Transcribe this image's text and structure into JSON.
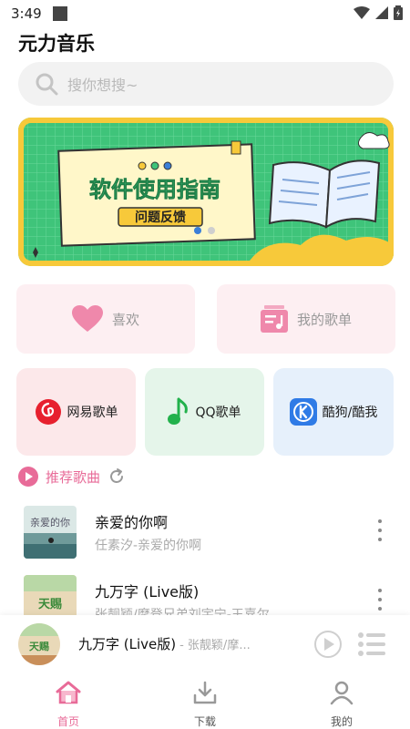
{
  "status_bar": {
    "time": "3:49"
  },
  "app": {
    "title": "元力音乐"
  },
  "search": {
    "placeholder": "搜你想搜~"
  },
  "banner": {
    "title": "软件使用指南",
    "subtitle": "问题反馈",
    "active_dot": 0,
    "dot_count": 2
  },
  "quick_actions": [
    {
      "label": "喜欢",
      "icon": "heart-icon"
    },
    {
      "label": "我的歌单",
      "icon": "playlist-icon"
    }
  ],
  "platforms": [
    {
      "label": "网易歌单",
      "icon": "netease-icon",
      "color": "#fce8ea"
    },
    {
      "label": "QQ歌单",
      "icon": "qq-music-icon",
      "color": "#e5f5ea"
    },
    {
      "label": "酷狗/酷我",
      "icon": "kugou-icon",
      "color": "#e6f0fb"
    }
  ],
  "recommend": {
    "title": "推荐歌曲"
  },
  "songs": [
    {
      "title": "亲爱的你啊",
      "subtitle": "任素汐-亲爱的你啊"
    },
    {
      "title": "九万字 (Live版)",
      "subtitle": "张靓颖/摩登兄弟刘宇宁-王嘉尔"
    }
  ],
  "now_playing": {
    "title": "九万字 (Live版)",
    "artist": "- 张靓颖/摩..."
  },
  "tabs": [
    {
      "label": "首页",
      "icon": "home-icon",
      "active": true
    },
    {
      "label": "下载",
      "icon": "download-icon",
      "active": false
    },
    {
      "label": "我的",
      "icon": "profile-icon",
      "active": false
    }
  ],
  "colors": {
    "accent": "#e86b98",
    "banner_green": "#3fc47a",
    "banner_yellow": "#f7c93a"
  }
}
